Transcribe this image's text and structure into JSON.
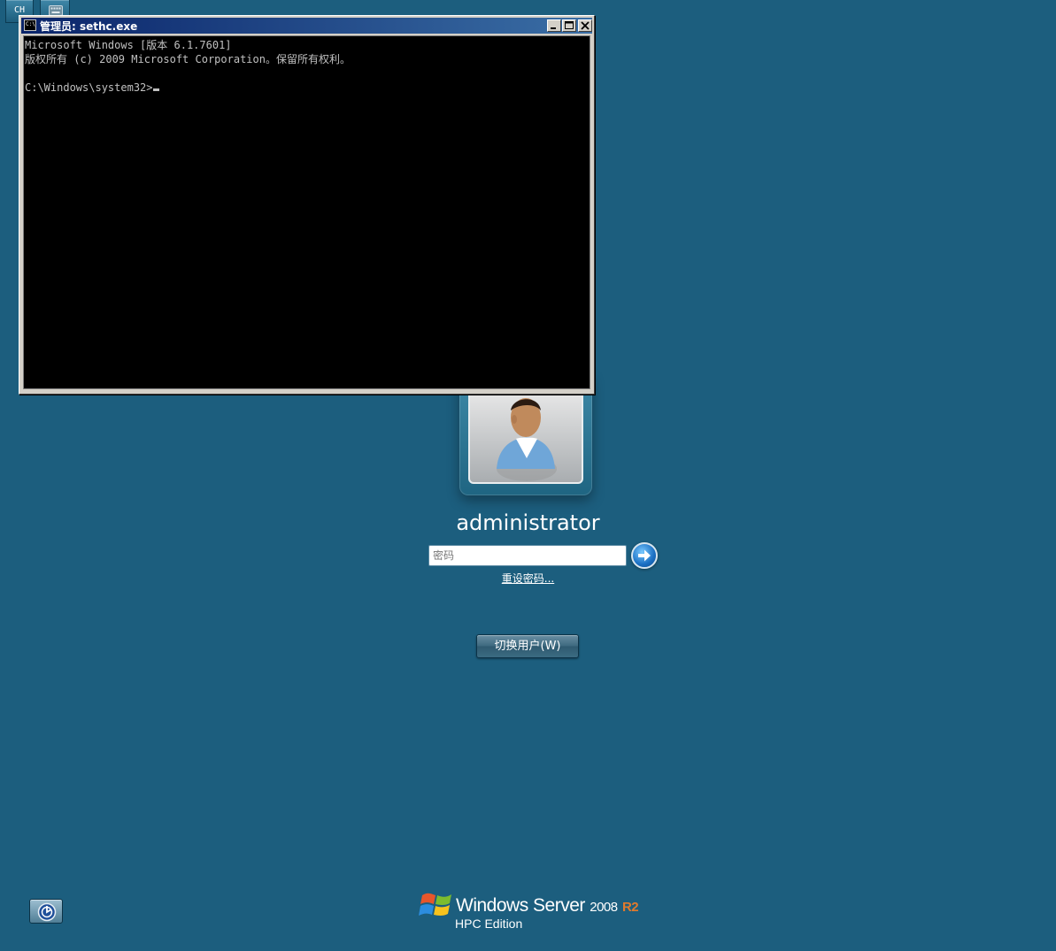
{
  "top_buttons": {
    "language": "CH"
  },
  "console": {
    "title": "管理员: sethc.exe",
    "lines": [
      "Microsoft Windows [版本 6.1.7601]",
      "版权所有 (c) 2009 Microsoft Corporation。保留所有权利。",
      "",
      "C:\\Windows\\system32>"
    ]
  },
  "login": {
    "username": "administrator",
    "password_placeholder": "密码",
    "reset_password_link": "重设密码...",
    "switch_user_button": "切换用户(W)"
  },
  "branding": {
    "product": "Windows Server",
    "version": "2008",
    "release": "R2",
    "edition": "HPC Edition"
  },
  "colors": {
    "desktop_background": "#1c5e7e",
    "console_background": "#000000",
    "console_text": "#c0c0c0",
    "titlebar_start": "#0a246a",
    "titlebar_end": "#3a6ea5",
    "r2_accent": "#e07a2c"
  },
  "icons": {
    "keyboard": "keyboard-icon",
    "ease_of_access": "ease-of-access-icon",
    "submit": "arrow-right-icon",
    "windows_logo": "windows-flag-icon",
    "avatar": "user-avatar-icon"
  }
}
